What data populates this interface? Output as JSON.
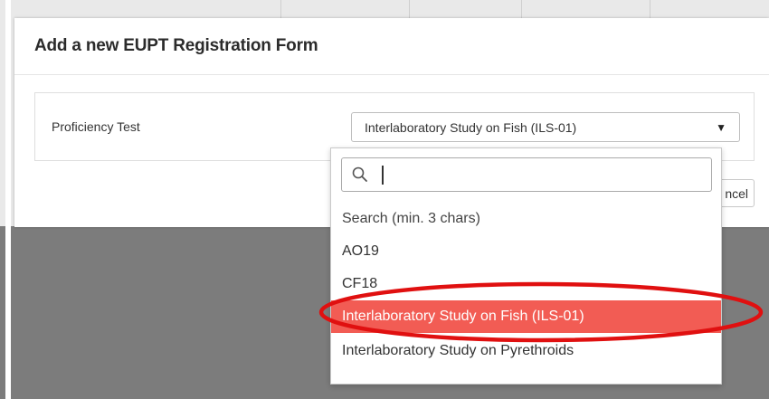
{
  "modal": {
    "title": "Add a new EUPT Registration Form",
    "field_label": "Proficiency Test",
    "selected_value": "Interlaboratory Study on Fish (ILS-01)",
    "cancel_label": "ncel"
  },
  "dropdown": {
    "search_value": "",
    "hint": "Search (min. 3 chars)",
    "options": [
      {
        "label": "AO19"
      },
      {
        "label": "CF18"
      },
      {
        "label": "Interlaboratory Study on Fish (ILS-01)",
        "highlighted": true
      },
      {
        "label": "Interlaboratory Study on Pyrethroids"
      }
    ]
  },
  "colors": {
    "highlight": "#f25c54",
    "annotation": "#e01010",
    "backdrop_dark": "#7c7c7c"
  },
  "icons": {
    "search": "search-icon",
    "caret": "caret-down-icon"
  }
}
